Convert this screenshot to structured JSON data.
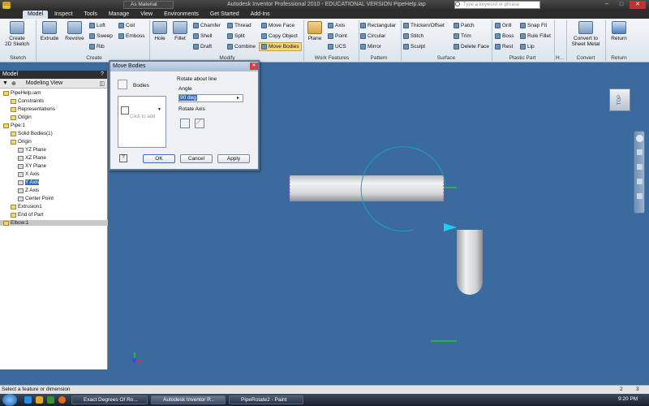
{
  "window": {
    "title": "Autodesk Inventor Professional 2010 - EDUCATIONAL VERSION   PipeHelp.iap",
    "material": "As Material",
    "search_placeholder": "Type a keyword or phrase",
    "pro_label": "PRO"
  },
  "menu": {
    "tabs": [
      "Model",
      "Inspect",
      "Tools",
      "Manage",
      "View",
      "Environments",
      "Get Started",
      "Add-Ins"
    ]
  },
  "ribbon": {
    "sketch": {
      "create_2d_sketch": "Create\n2D Sketch",
      "panel": "Sketch"
    },
    "create": {
      "extrude": "Extrude",
      "revolve": "Revolve",
      "loft": "Loft",
      "sweep": "Sweep",
      "rib": "Rib",
      "coil": "Coil",
      "emboss": "Emboss",
      "panel": "Create"
    },
    "modify": {
      "hole": "Hole",
      "fillet": "Fillet",
      "chamfer": "Chamfer",
      "shell": "Shell",
      "draft": "Draft",
      "thread": "Thread",
      "split": "Split",
      "combine": "Combine",
      "move_face": "Move Face",
      "copy_object": "Copy Object",
      "move_bodies": "Move Bodies",
      "panel": "Modify"
    },
    "work_features": {
      "plane": "Plane",
      "axis": "Axis",
      "point": "Point",
      "ucs": "UCS",
      "panel": "Work Features"
    },
    "pattern": {
      "rectangular": "Rectangular",
      "circular": "Circular",
      "mirror": "Mirror",
      "panel": "Pattern"
    },
    "surface": {
      "thicken_offset": "Thicken/Offset",
      "stitch": "Stitch",
      "sculpt": "Sculpt",
      "patch": "Patch",
      "trim": "Trim",
      "delete_face": "Delete Face",
      "panel": "Surface"
    },
    "plastic_part": {
      "grill": "Grill",
      "boss": "Boss",
      "rest": "Rest",
      "snap_fit": "Snap Fit",
      "rule_fillet": "Rule Fillet",
      "lip": "Lip",
      "panel": "Plastic Part"
    },
    "harness_short": "H...",
    "convert": {
      "convert_to_sheet_metal": "Convert to\nSheet Metal",
      "panel": "Convert"
    },
    "return": {
      "return": "Return",
      "panel": "Return"
    }
  },
  "browser": {
    "header": "Model",
    "view_mode": "Modeling View",
    "items": [
      {
        "label": "PipeHelp.iam",
        "depth": 0
      },
      {
        "label": "Constraints",
        "depth": 1
      },
      {
        "label": "Representations",
        "depth": 1
      },
      {
        "label": "Origin",
        "depth": 1
      },
      {
        "label": "Pipe:1",
        "depth": 0
      },
      {
        "label": "Solid Bodies(1)",
        "depth": 1
      },
      {
        "label": "Origin",
        "depth": 1
      },
      {
        "label": "YZ Plane",
        "depth": 2
      },
      {
        "label": "XZ Plane",
        "depth": 2
      },
      {
        "label": "XY Plane",
        "depth": 2
      },
      {
        "label": "X Axis",
        "depth": 2
      },
      {
        "label": "Y Axis",
        "depth": 2
      },
      {
        "label": "Z Axis",
        "depth": 2
      },
      {
        "label": "Center Point",
        "depth": 2
      },
      {
        "label": "Extrusion1",
        "depth": 1
      },
      {
        "label": "End of Part",
        "depth": 1
      },
      {
        "label": "Elbow:1",
        "depth": 0
      }
    ]
  },
  "dialog": {
    "title": "Move Bodies",
    "bodies_label": "Bodies",
    "click_to_add": "Click to add",
    "rotate_about_line": "Rotate about line",
    "angle_label": "Angle",
    "angle_value": "90 deg",
    "rotate_axis_label": "Rotate Axis",
    "ok": "OK",
    "cancel": "Cancel",
    "apply": "Apply"
  },
  "viewcube": {
    "face": "TOP"
  },
  "status": {
    "message": "Select a feature or dimension",
    "count1": "2",
    "count2": "3"
  },
  "taskbar": {
    "items": [
      "Exact Degrees Of Ro...",
      "Autodesk Inventor P...",
      "PipeRotate2 - Paint"
    ],
    "clock": "9:20 PM"
  }
}
